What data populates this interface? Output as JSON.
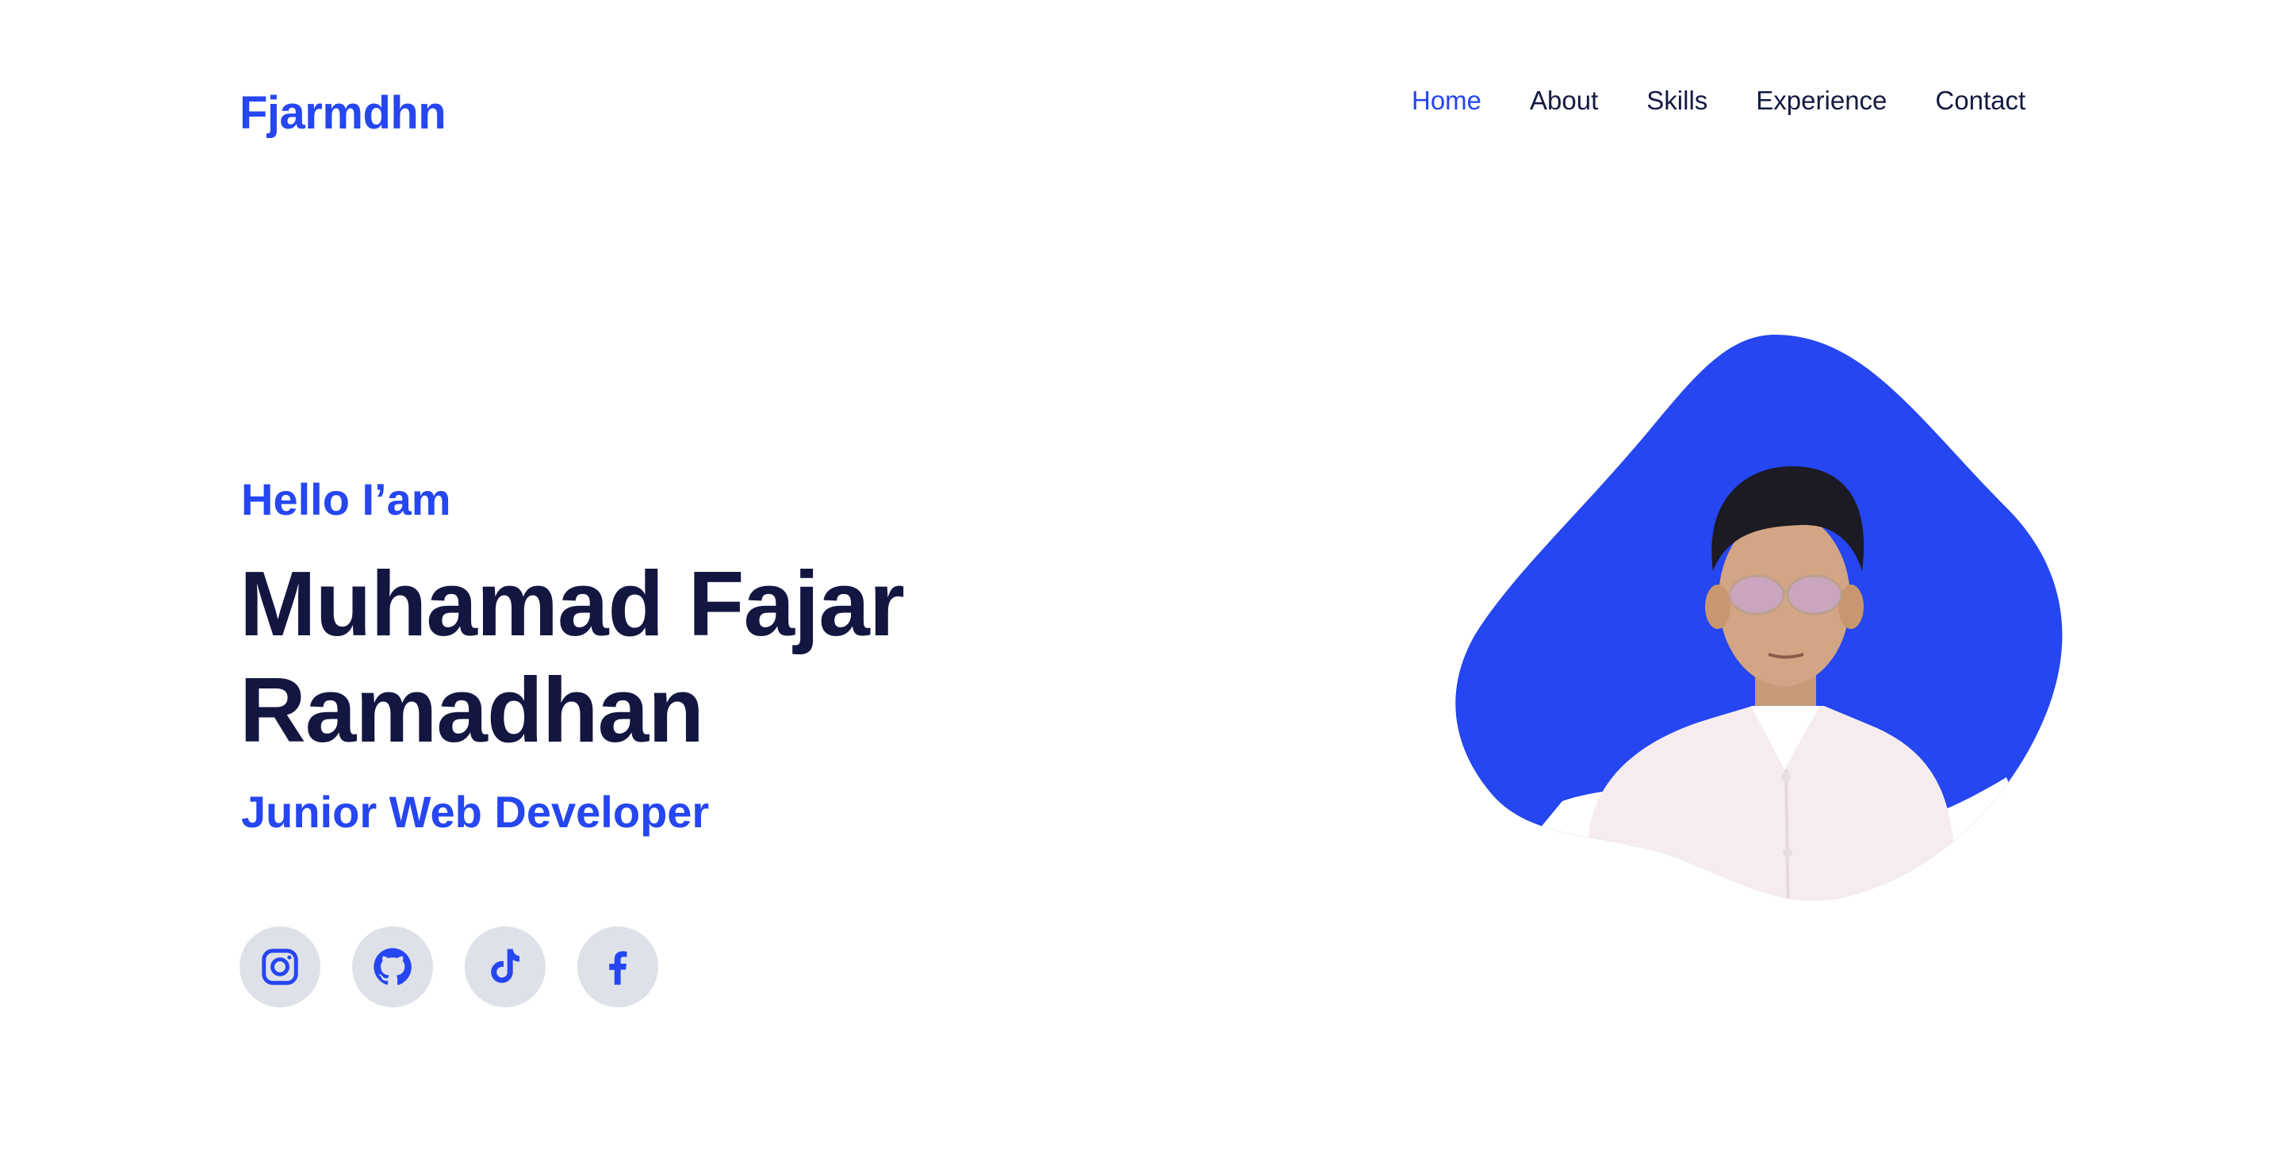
{
  "header": {
    "logo": "Fjarmdhn",
    "nav": [
      {
        "label": "Home",
        "active": true
      },
      {
        "label": "About",
        "active": false
      },
      {
        "label": "Skills",
        "active": false
      },
      {
        "label": "Experience",
        "active": false
      },
      {
        "label": "Contact",
        "active": false
      }
    ]
  },
  "hero": {
    "greeting": "Hello I’am",
    "name_line1": "Muhamad Fajar",
    "name_line2": "Ramadhan",
    "role": "Junior Web Developer"
  },
  "socials": [
    {
      "icon": "instagram-icon"
    },
    {
      "icon": "github-icon"
    },
    {
      "icon": "tiktok-icon"
    },
    {
      "icon": "facebook-icon"
    }
  ],
  "colors": {
    "accent": "#2546f0",
    "heading": "#131640",
    "icon_bg": "#dfe1e8"
  }
}
